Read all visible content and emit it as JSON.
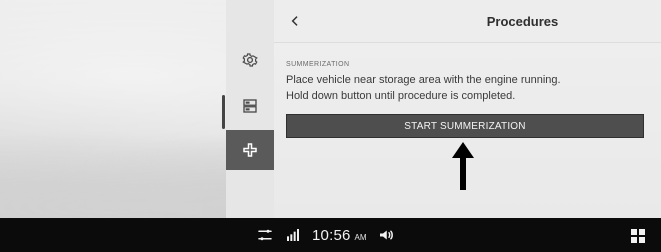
{
  "header": {
    "title": "Procedures"
  },
  "main": {
    "section_label": "SUMMERIZATION",
    "instruction_line_1": "Place vehicle near storage area with the engine running.",
    "instruction_line_2": "Hold down button until procedure is completed.",
    "start_button_label": "START SUMMERIZATION"
  },
  "sidebar": {
    "items": [
      {
        "icon": "gear-icon"
      },
      {
        "icon": "storage-icon"
      },
      {
        "icon": "plus-icon",
        "active": true
      }
    ]
  },
  "status_bar": {
    "time": "10:56",
    "ampm": "AM",
    "icons": [
      "settings-sliders-icon",
      "signal-icon",
      "volume-icon",
      "grid-icon"
    ]
  }
}
